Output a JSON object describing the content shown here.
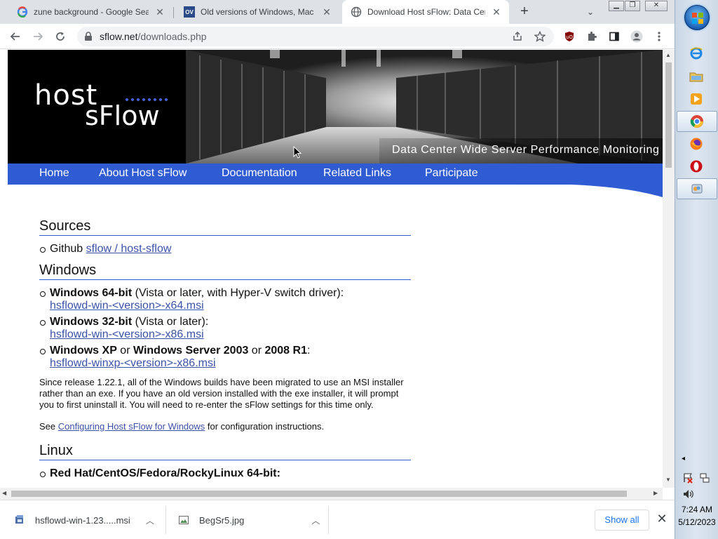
{
  "tabs": [
    {
      "title": "zune background - Google Search",
      "favicon": "google-icon"
    },
    {
      "title": "Old versions of Windows, Mac and",
      "favicon": "ov-icon"
    },
    {
      "title": "Download Host sFlow: Data Center",
      "favicon": "globe-icon",
      "active": true
    }
  ],
  "address": {
    "host": "sflow.net",
    "path": "/downloads.php"
  },
  "banner": {
    "logo_top": "host",
    "logo_bottom": "sFlow",
    "tagline": "Data Center Wide Server Performance Monitoring"
  },
  "nav": [
    "Home",
    "About Host sFlow",
    "Documentation",
    "Related Links",
    "Participate"
  ],
  "sources": {
    "heading": "Sources",
    "item_prefix": "Github ",
    "item_link": "sflow / host-sflow"
  },
  "windows": {
    "heading": "Windows",
    "items": [
      {
        "bold1": "Windows 64-bit",
        "rest1": " (Vista or later, with Hyper-V switch driver):",
        "link": "hsflowd-win-<version>-x64.msi"
      },
      {
        "bold1": "Windows 32-bit",
        "rest1": " (Vista or later):",
        "link": "hsflowd-win-<version>-x86.msi"
      },
      {
        "bold1": "Windows XP",
        "mid1": " or ",
        "bold2": "Windows Server 2003",
        "mid2": " or ",
        "bold3": "2008 R1",
        "rest1": ":",
        "link": "hsflowd-winxp-<version>-x86.msi"
      }
    ],
    "note": "Since release 1.22.1, all of the Windows builds have been migrated to use an MSI installer rather than an exe. If you have an old version installed with the exe installer, it will prompt you to first uninstall it. You will need to re-enter the sFlow settings for this time only.",
    "see_prefix": "See ",
    "see_link": "Configuring Host sFlow for Windows",
    "see_suffix": " for configuration instructions."
  },
  "linux": {
    "heading": "Linux",
    "first_item": "Red Hat/CentOS/Fedora/RockyLinux 64-bit:"
  },
  "downloads": [
    {
      "name": "hsflowd-win-1.23.....msi",
      "icon": "msi-file-icon"
    },
    {
      "name": "BegSr5.jpg",
      "icon": "image-file-icon"
    }
  ],
  "shelf": {
    "show_all": "Show all"
  },
  "clock": {
    "time": "7:24 AM",
    "date": "5/12/2023"
  },
  "colors": {
    "nav_blue": "#2f5bd3",
    "link": "#3b51a8",
    "chrome_tabstrip": "#dee1e6"
  }
}
